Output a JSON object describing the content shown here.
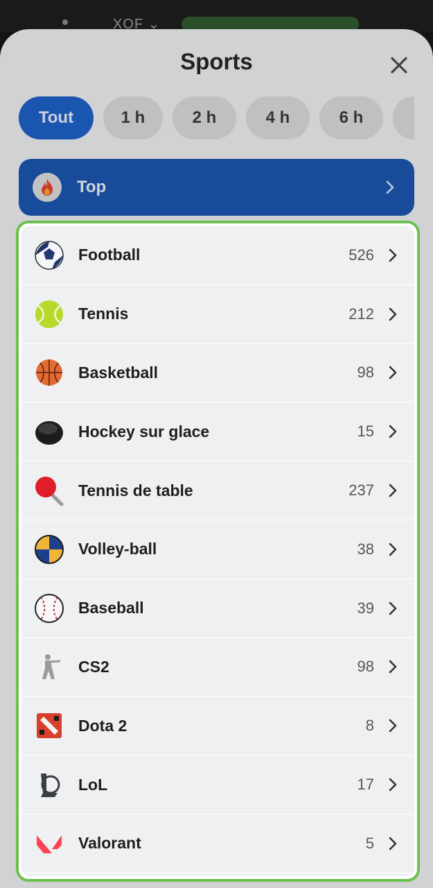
{
  "status": {
    "currency": "XOF ⌄"
  },
  "sheet": {
    "title": "Sports",
    "close_icon": "close-icon"
  },
  "filters": [
    {
      "label": "Tout",
      "active": true
    },
    {
      "label": "1 h",
      "active": false
    },
    {
      "label": "2 h",
      "active": false
    },
    {
      "label": "4 h",
      "active": false
    },
    {
      "label": "6 h",
      "active": false
    },
    {
      "label": "",
      "active": false
    }
  ],
  "top": {
    "label": "Top",
    "icon": "flame-icon"
  },
  "sports": [
    {
      "name": "Football",
      "count": "526",
      "icon": "football-icon"
    },
    {
      "name": "Tennis",
      "count": "212",
      "icon": "tennis-ball-icon"
    },
    {
      "name": "Basketball",
      "count": "98",
      "icon": "basketball-icon"
    },
    {
      "name": "Hockey sur glace",
      "count": "15",
      "icon": "hockey-puck-icon"
    },
    {
      "name": "Tennis de table",
      "count": "237",
      "icon": "ping-pong-paddle-icon"
    },
    {
      "name": "Volley-ball",
      "count": "38",
      "icon": "volleyball-icon"
    },
    {
      "name": "Baseball",
      "count": "39",
      "icon": "baseball-icon"
    },
    {
      "name": "CS2",
      "count": "98",
      "icon": "cs2-soldier-icon"
    },
    {
      "name": "Dota 2",
      "count": "8",
      "icon": "dota2-icon"
    },
    {
      "name": "LoL",
      "count": "17",
      "icon": "lol-icon"
    },
    {
      "name": "Valorant",
      "count": "5",
      "icon": "valorant-icon"
    }
  ],
  "colors": {
    "accent_blue": "#1d5fc4",
    "highlight_green": "#6cc04f"
  }
}
